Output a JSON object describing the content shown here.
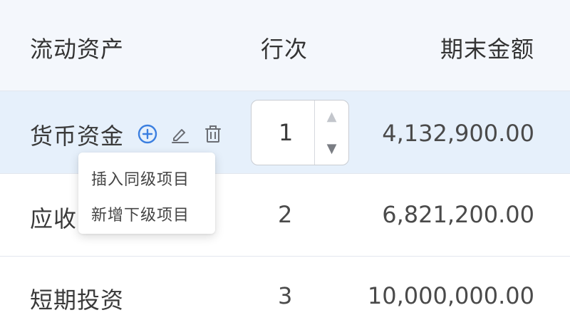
{
  "table": {
    "columns": [
      "流动资产",
      "行次",
      "期末金额"
    ],
    "rows": [
      {
        "name": "货币资金",
        "seq": "1",
        "amount": "4,132,900.00"
      },
      {
        "name": "应收",
        "seq": "2",
        "amount": "6,821,200.00"
      },
      {
        "name": "短期投资",
        "seq": "3",
        "amount": "10,000,000.00"
      }
    ]
  },
  "row_actions": {
    "icons": [
      "add-circle-icon",
      "edit-icon",
      "delete-icon"
    ]
  },
  "popup": {
    "items": [
      "插入同级项目",
      "新增下级项目"
    ]
  },
  "colors": {
    "accent": "#3b7fe0",
    "header_bg": "#f4f7fc",
    "selected_row_bg": "#e6f0fb",
    "border": "#e3e7ee"
  }
}
